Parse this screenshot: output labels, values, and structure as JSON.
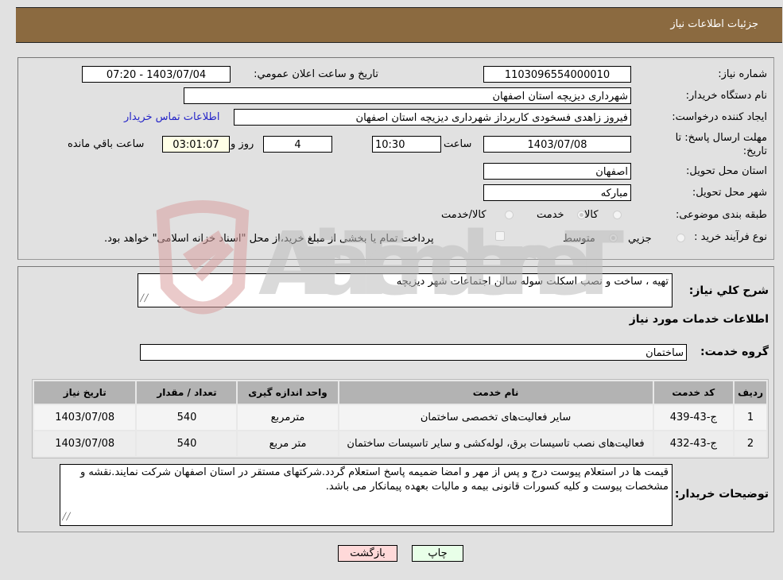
{
  "header": {
    "title": "جزئیات اطلاعات نیاز"
  },
  "details": {
    "need_number": {
      "label": "شماره نیاز:",
      "value": "1103096554000010"
    },
    "announce_datetime": {
      "label": "تاریخ و ساعت اعلان عمومي:",
      "value": "1403/07/04 - 07:20"
    },
    "buyer_org": {
      "label": "نام دستگاه خریدار:",
      "value": "شهرداری دیزیچه استان اصفهان"
    },
    "requester": {
      "label": "ایجاد کننده درخواست:",
      "value": "فیروز زاهدی فسخودی کاربرداز شهرداری دیزیچه استان اصفهان"
    },
    "buyer_contact_link": "اطلاعات تماس خریدار",
    "deadline": {
      "label": "مهلت ارسال پاسخ: تا تاریخ:",
      "date": "1403/07/08",
      "time_label": "ساعت",
      "time": "10:30",
      "days": "4",
      "days_label": "روز و",
      "remaining": "03:01:07",
      "remaining_label": "ساعت باقي مانده"
    },
    "delivery_province": {
      "label": "استان محل تحویل:",
      "value": "اصفهان"
    },
    "delivery_city": {
      "label": "شهر محل تحویل:",
      "value": "مبارکه"
    },
    "category": {
      "label": "طبقه بندی موضوعی:",
      "options": [
        {
          "label": "کالا",
          "checked": false
        },
        {
          "label": "خدمت",
          "checked": true
        },
        {
          "label": "کالا/خدمت",
          "checked": false
        }
      ]
    },
    "purchase_type": {
      "label": "نوع فرآیند خرید :",
      "options": [
        {
          "label": "جزیي",
          "checked": false
        },
        {
          "label": "متوسط",
          "checked": true
        }
      ],
      "treasury_checkbox_label": "پرداخت تمام یا بخشی از مبلغ خرید،از محل \"اسناد خزانه اسلامی\" خواهد بود.",
      "treasury_checked": false
    }
  },
  "summary": {
    "label": "شرح کلي نیاز:",
    "value": "تهیه ، ساخت و نصب اسکلت سوله سالن اجتماعات شهر دیزیچه"
  },
  "services_section_title": "اطلاعات خدمات مورد نیاز",
  "service_group": {
    "label": "گروه خدمت:",
    "value": "ساختمان"
  },
  "table": {
    "headers": [
      "ردیف",
      "کد خدمت",
      "نام خدمت",
      "واحد اندازه گیری",
      "تعداد / مقدار",
      "تاریخ نیاز"
    ],
    "rows": [
      [
        "1",
        "ج-43-439",
        "سایر فعالیت‌های تخصصی ساختمان",
        "مترمربع",
        "540",
        "1403/07/08"
      ],
      [
        "2",
        "ج-43-432",
        "فعالیت‌های نصب تاسیسات برق، لوله‌کشی و سایر تاسیسات ساختمان",
        "متر مربع",
        "540",
        "1403/07/08"
      ]
    ]
  },
  "buyer_notes": {
    "label": "توضیحات خریدار:",
    "value": "قیمت ها در استعلام پیوست درج و پس از مهر و امضا ضمیمه پاسخ استعلام گردد.شرکتهای مستقر در استان اصفهان شرکت نمایند.نقشه و مشخصات پیوست و کلیه کسورات قانونی بیمه و مالیات بعهده پیمانکار می باشد."
  },
  "buttons": {
    "print": "چاپ",
    "back": "بازگشت"
  },
  "watermark": {
    "text": "AriaTender.neT"
  },
  "colors": {
    "header_bg": "#8b6a40",
    "back_bg": "#ffd9d9",
    "print_bg": "#e8ffe8",
    "link": "#2424c8"
  }
}
